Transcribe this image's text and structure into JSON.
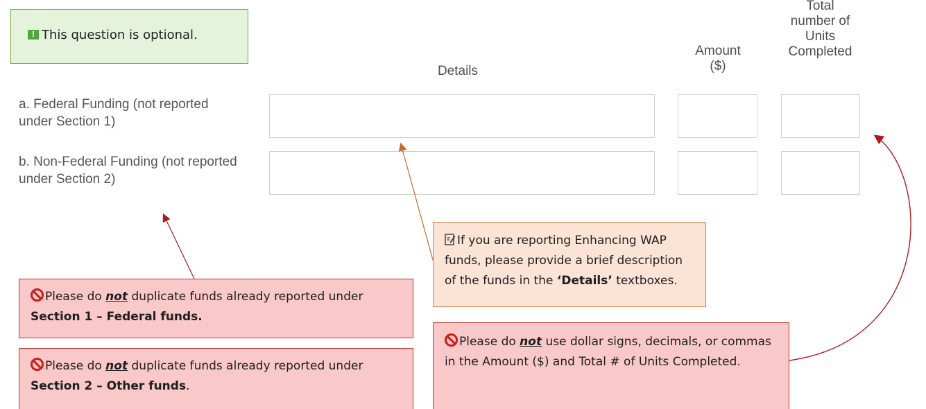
{
  "optional_notice": {
    "icon": "flag-icon",
    "text": "This question is optional."
  },
  "columns": {
    "details": "Details",
    "amount": "Amount\n($)",
    "units": "Total\nnumber of\nUnits\nCompleted"
  },
  "rows": [
    {
      "label": "a. Federal Funding (not reported under Section 1)",
      "details": "",
      "amount": "",
      "units": ""
    },
    {
      "label": "b. Non-Federal Funding (not reported under Section 2)",
      "details": "",
      "amount": "",
      "units": ""
    }
  ],
  "callouts": {
    "details_note": {
      "icon": "note-icon",
      "pre": "If you are reporting Enhancing WAP funds, please provide a brief description of the funds in the ",
      "bold": "‘Details’",
      "post": " textboxes."
    },
    "no_dup_federal": {
      "icon": "ban-icon",
      "pre": "Please do ",
      "emph": "not",
      "mid": " duplicate funds already reported under ",
      "bold": "Section 1 – Federal funds.",
      "post": ""
    },
    "no_dup_other": {
      "icon": "ban-icon",
      "pre": "Please do ",
      "emph": "not",
      "mid": " duplicate funds already reported under ",
      "bold": "Section 2 – Other funds",
      "post": "."
    },
    "no_symbols": {
      "icon": "ban-icon",
      "pre": "Please do ",
      "emph": "not",
      "post": " use dollar signs, decimals, or commas in the Amount ($) and Total # of Units Completed."
    }
  },
  "colors": {
    "green_border": "#6aab49",
    "green_bg": "#e5f3dd",
    "red_border": "#c0302b",
    "red_bg": "#f9c8c8",
    "orange_border": "#d7803f",
    "orange_bg": "#fbe3d5",
    "arrow_dark_red": "#b0181b",
    "arrow_orange": "#c96a2a"
  }
}
